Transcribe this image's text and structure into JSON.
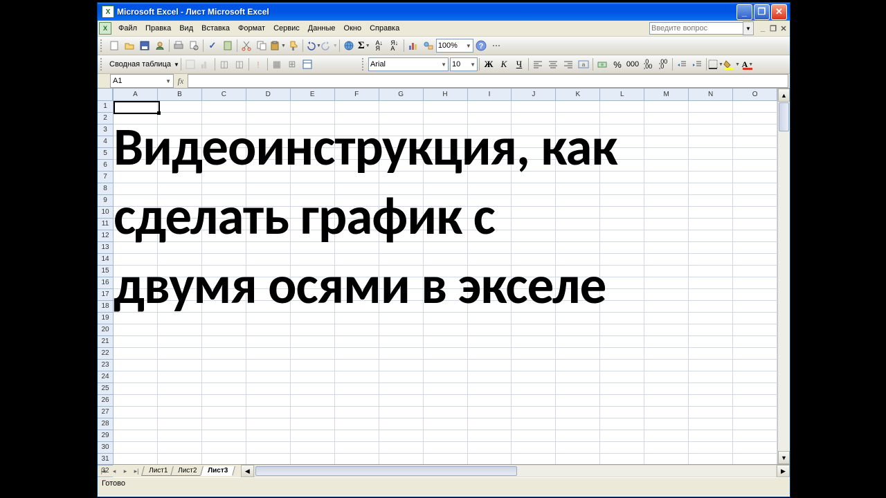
{
  "window": {
    "title": "Microsoft Excel - Лист Microsoft Excel"
  },
  "menu": {
    "items": [
      "Файл",
      "Правка",
      "Вид",
      "Вставка",
      "Формат",
      "Сервис",
      "Данные",
      "Окно",
      "Справка"
    ]
  },
  "help_placeholder": "Введите вопрос",
  "toolbar2": {
    "pivot_label": "Сводная таблица"
  },
  "format_bar": {
    "font": "Arial",
    "size": "10",
    "zoom": "100%"
  },
  "namebox": "A1",
  "columns": [
    "A",
    "B",
    "C",
    "D",
    "E",
    "F",
    "G",
    "H",
    "I",
    "J",
    "K",
    "L",
    "M",
    "N",
    "O"
  ],
  "rows": [
    "1",
    "2",
    "3",
    "4",
    "5",
    "6",
    "7",
    "8",
    "9",
    "10",
    "11",
    "12",
    "13",
    "14",
    "15",
    "16",
    "17",
    "18",
    "19",
    "20",
    "21",
    "22",
    "23",
    "24",
    "25",
    "26",
    "27",
    "28",
    "29",
    "30",
    "31",
    "32"
  ],
  "sheets": {
    "tabs": [
      "Лист1",
      "Лист2",
      "Лист3"
    ],
    "active": 2
  },
  "status": "Готово",
  "overlay": "Видеоинструкция, как\nсделать график с\nдвумя осями в экселе"
}
